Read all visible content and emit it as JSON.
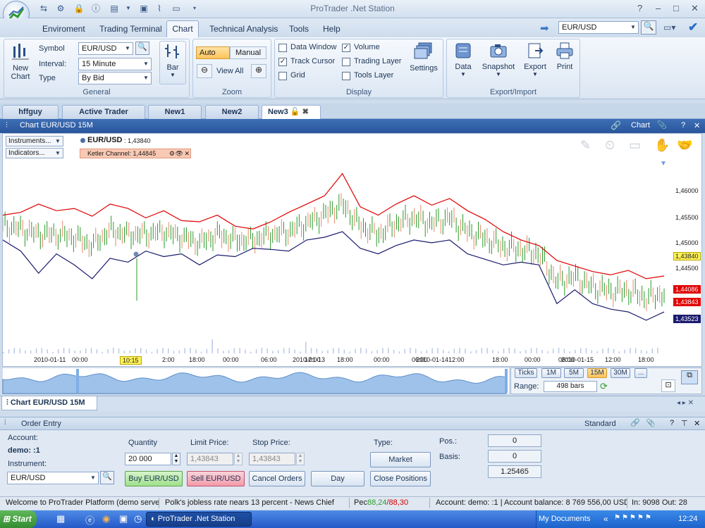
{
  "window": {
    "title": "ProTrader .Net Station",
    "controls": [
      "?",
      "–",
      "□",
      "✕"
    ]
  },
  "menu": {
    "items": [
      "Enviroment",
      "Trading Terminal",
      "Chart",
      "Technical Analysis",
      "Tools",
      "Help"
    ],
    "active": "Chart",
    "symbol_value": "EUR/USD"
  },
  "ribbon": {
    "new_chart": [
      "New",
      "Chart"
    ],
    "symbol_label": "Symbol",
    "symbol_value": "EUR/USD",
    "interval_label": "Interval:",
    "interval_value": "15 Minute",
    "type_label": "Type",
    "type_value": "By Bid",
    "bar_label": "Bar",
    "general_label": "General",
    "auto": "Auto",
    "manual": "Manual",
    "view_all": "View All",
    "zoom_label": "Zoom",
    "data_window": "Data Window",
    "track_cursor": "Track Cursor",
    "grid": "Grid",
    "volume": "Volume",
    "trading_layer": "Trading Layer",
    "tools_layer": "Tools Layer",
    "settings": "Settings",
    "display_label": "Display",
    "data": "Data",
    "snapshot": "Snapshot",
    "export": "Export",
    "print": "Print",
    "export_import_label": "Export/Import",
    "checks": {
      "data_window": false,
      "track_cursor": true,
      "grid": false,
      "volume": true,
      "trading_layer": false,
      "tools_layer": false
    }
  },
  "doc_tabs": [
    "hffguy",
    "Active Trader",
    "New1",
    "New2",
    "New3"
  ],
  "chart_panel": {
    "title": "Chart EUR/USD 15M",
    "right_label": "Chart",
    "bottom_title": "Chart EUR/USD 15M"
  },
  "chart": {
    "instruments": "Instruments...",
    "indicators": "Indicators...",
    "symbol": "EUR/USD",
    "last": ": 1,43840",
    "indicator": "Ketler Channel: 1,44845",
    "y_ticks": [
      "1,46000",
      "1,45500",
      "1,45000",
      "1,44500"
    ],
    "price_tags": [
      "1,43840",
      "1,44086",
      "1,43843",
      "1,43523"
    ],
    "x_ticks": [
      "2010-01-11",
      "00:00",
      "10:15",
      "2:00",
      "18:00",
      "00:00",
      "06:00",
      "2010-01-13",
      "12:00",
      "18:00",
      "00:00",
      "06:00",
      "2010-01-14",
      "12:00",
      "18:00",
      "00:00",
      "06:00",
      "2010-01-15",
      "12:00",
      "18:00"
    ],
    "ranges": [
      "Ticks",
      "1M",
      "5M",
      "15M",
      "30M",
      "..."
    ],
    "range_label": "Range:",
    "range_value": "498 bars"
  },
  "chart_data": {
    "type": "line",
    "ylim": [
      1.429,
      1.464
    ],
    "series": [
      {
        "name": "",
        "color": "#e00000",
        "values": [
          1.454,
          1.4545,
          1.456,
          1.4548,
          1.4552,
          1.4538,
          1.456,
          1.4552,
          1.4535,
          1.4548,
          1.453,
          1.4528,
          1.454,
          1.452,
          1.4515,
          1.4528,
          1.4545,
          1.456,
          1.4575,
          1.4615,
          1.4555,
          1.454,
          1.456,
          1.4575,
          1.4558,
          1.457,
          1.4548,
          1.4532,
          1.451,
          1.4495,
          1.4485,
          1.4458,
          1.4448,
          1.4438,
          1.4432,
          1.444,
          1.4425,
          1.443
        ]
      },
      {
        "name": "",
        "color": "#1a1a6e",
        "values": [
          1.4495,
          1.4475,
          1.4435,
          1.447,
          1.445,
          1.4425,
          1.4462,
          1.4455,
          1.4475,
          1.4465,
          1.447,
          1.445,
          1.4468,
          1.4465,
          1.448,
          1.4478,
          1.4475,
          1.4495,
          1.45,
          1.451,
          1.448,
          1.447,
          1.4485,
          1.4495,
          1.449,
          1.4495,
          1.447,
          1.446,
          1.445,
          1.4455,
          1.445,
          1.438,
          1.4405,
          1.438,
          1.437,
          1.4365,
          1.435,
          1.4365
        ]
      },
      {
        "name": "",
        "color": "#2a9a2a",
        "values": [
          1.452,
          1.4515,
          1.4505,
          1.4505,
          1.45,
          1.4485,
          1.4512,
          1.4505,
          1.4505,
          1.451,
          1.45,
          1.449,
          1.4505,
          1.4495,
          1.4495,
          1.4505,
          1.451,
          1.4525,
          1.454,
          1.456,
          1.452,
          1.4505,
          1.4525,
          1.4535,
          1.4525,
          1.4535,
          1.451,
          1.4498,
          1.4482,
          1.4478,
          1.447,
          1.442,
          1.4428,
          1.441,
          1.4402,
          1.4403,
          1.439,
          1.4398
        ]
      }
    ]
  },
  "order": {
    "title": "Order Entry",
    "mode": "Standard",
    "account_label": "Account:",
    "account_value": "demo: :1",
    "instrument_label": "Instrument:",
    "instrument_value": "EUR/USD",
    "quantity_label": "Quantity",
    "quantity": "20 000",
    "limit_label": "Limit Price:",
    "limit": "1,43843",
    "stop_label": "Stop Price:",
    "stop": "1,43843",
    "buy": "Buy EUR/USD",
    "sell": "Sell EUR/USD",
    "cancel": "Cancel Orders",
    "day": "Day",
    "type_label": "Type:",
    "type_value": "Market",
    "close": "Close Positions",
    "pos_label": "Pos.:",
    "pos_value": "0",
    "basis_label": "Basis:",
    "basis_value": "0",
    "extra_value": "1.25465"
  },
  "status": {
    "welcome": "Welcome to ProTrader Platform (demo server)",
    "news": "Polk's jobless rate nears 13 percent - News Chief",
    "pec": "Pec",
    "green": "88,24",
    "red": "/88,30",
    "account": "Account: demo: :1 | Account balance: 8 769 556,00 USD",
    "io": "In: 9098 Out: 28"
  },
  "taskbar": {
    "start": "Start",
    "app": "ProTrader .Net Station",
    "docs": "My Documents",
    "tray_arrows": "«",
    "time": "12:24"
  }
}
